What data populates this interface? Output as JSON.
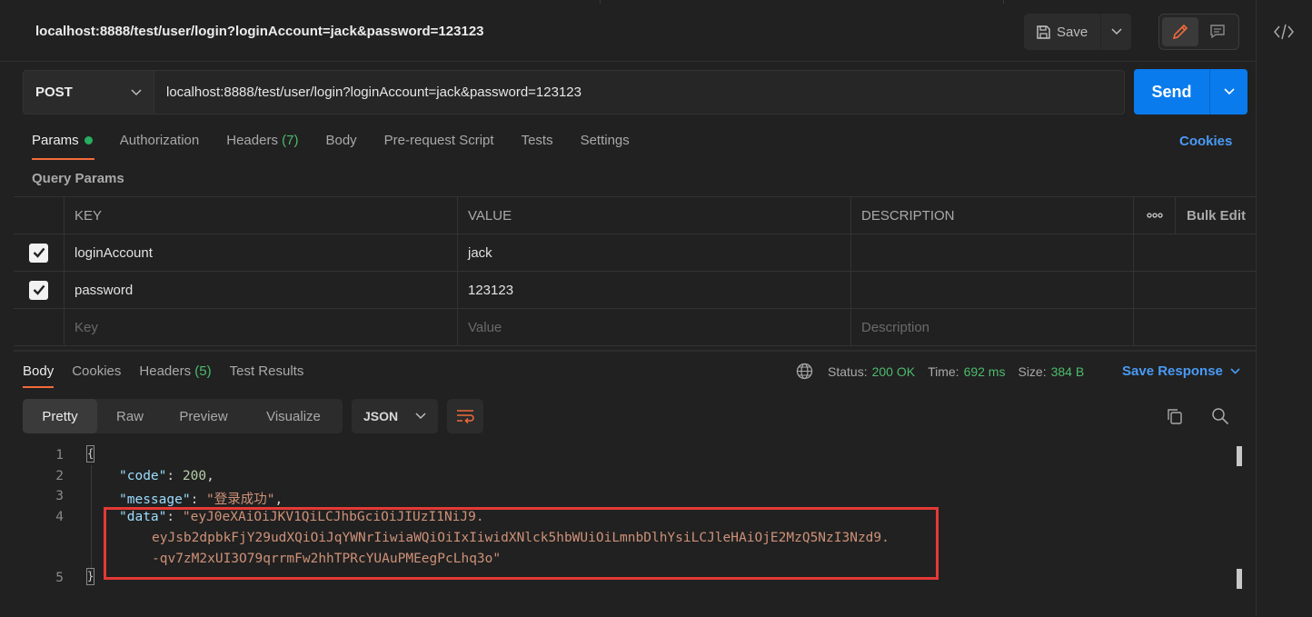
{
  "request": {
    "title": "localhost:8888/test/user/login?loginAccount=jack&password=123123",
    "method": "POST",
    "url": "localhost:8888/test/user/login?loginAccount=jack&password=123123",
    "save_label": "Save",
    "send_label": "Send"
  },
  "request_tabs": {
    "params": "Params",
    "authorization": "Authorization",
    "headers": "Headers",
    "headers_count": "(7)",
    "body": "Body",
    "prerequest": "Pre-request Script",
    "tests": "Tests",
    "settings": "Settings",
    "cookies": "Cookies"
  },
  "query_params": {
    "label": "Query Params",
    "columns": {
      "key": "KEY",
      "value": "VALUE",
      "description": "DESCRIPTION",
      "more": "ooo",
      "bulk_edit": "Bulk Edit"
    },
    "rows": [
      {
        "checked": true,
        "key": "loginAccount",
        "value": "jack",
        "description": ""
      },
      {
        "checked": true,
        "key": "password",
        "value": "123123",
        "description": ""
      }
    ],
    "placeholders": {
      "key": "Key",
      "value": "Value",
      "description": "Description"
    }
  },
  "response_tabs": {
    "body": "Body",
    "cookies": "Cookies",
    "headers": "Headers",
    "headers_count": "(5)",
    "test_results": "Test Results"
  },
  "response_stats": {
    "status_label": "Status:",
    "status_value": "200 OK",
    "time_label": "Time:",
    "time_value": "692 ms",
    "size_label": "Size:",
    "size_value": "384 B",
    "save_response": "Save Response"
  },
  "view_modes": {
    "pretty": "Pretty",
    "raw": "Raw",
    "preview": "Preview",
    "visualize": "Visualize",
    "format": "JSON"
  },
  "response_body": {
    "line_numbers": [
      "1",
      "2",
      "3",
      "4",
      "5"
    ],
    "open_brace": "{",
    "close_brace": "}",
    "code_key": "\"code\"",
    "code_value": "200",
    "message_key": "\"message\"",
    "message_value": "\"登录成功\"",
    "data_key": "\"data\"",
    "data_line1": "\"eyJ0eXAiOiJKV1QiLCJhbGciOiJIUzI1NiJ9.",
    "data_line2": "eyJsb2dpbkFjY29udXQiOiJqYWNrIiwiaWQiOiIxIiwidXNlck5hbWUiOiLmnbDlhYsiLCJleHAiOjE2MzQ5NzI3Nzd9.",
    "data_line3": "-qv7zM2xUI3O79qrrmFw2hhTPRcYUAuPMEegPcLhq3o\""
  },
  "colors": {
    "accent": "#f26b3a",
    "send": "#097bed",
    "link": "#4a9af5",
    "status_ok": "#4cbb6c",
    "highlight": "#e53935"
  }
}
